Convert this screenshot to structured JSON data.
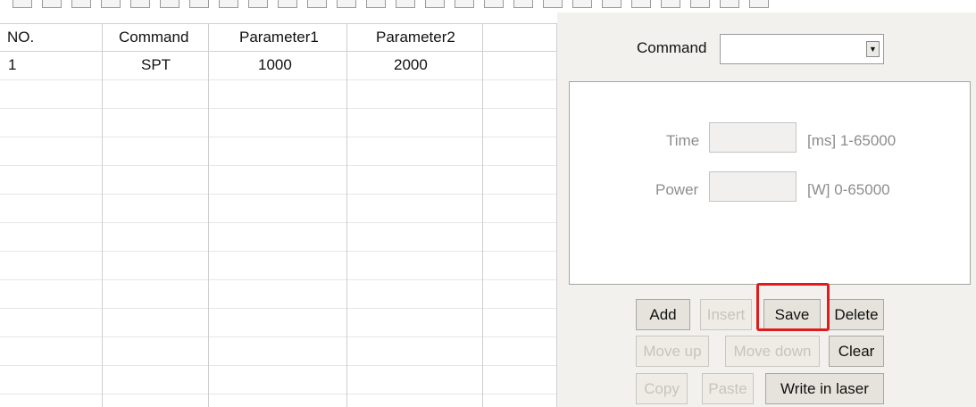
{
  "table": {
    "headers": [
      "NO.",
      "Command",
      "Parameter1",
      "Parameter2"
    ],
    "rows": [
      {
        "no": "1",
        "command": "SPT",
        "param1": "1000",
        "param2": "2000"
      }
    ]
  },
  "panel": {
    "command_label": "Command",
    "command_value": "",
    "time_label": "Time",
    "time_value": "",
    "time_range": "[ms] 1-65000",
    "power_label": "Power",
    "power_value": "",
    "power_range": "[W] 0-65000"
  },
  "buttons": {
    "add": "Add",
    "insert": "Insert",
    "save": "Save",
    "delete": "Delete",
    "move_up": "Move up",
    "move_down": "Move down",
    "clear": "Clear",
    "copy": "Copy",
    "paste": "Paste",
    "write": "Write in laser"
  },
  "colors": {
    "highlight": "#e01b1b",
    "panel_bg": "#f2f1ee",
    "button_bg": "#e6e3dc"
  }
}
